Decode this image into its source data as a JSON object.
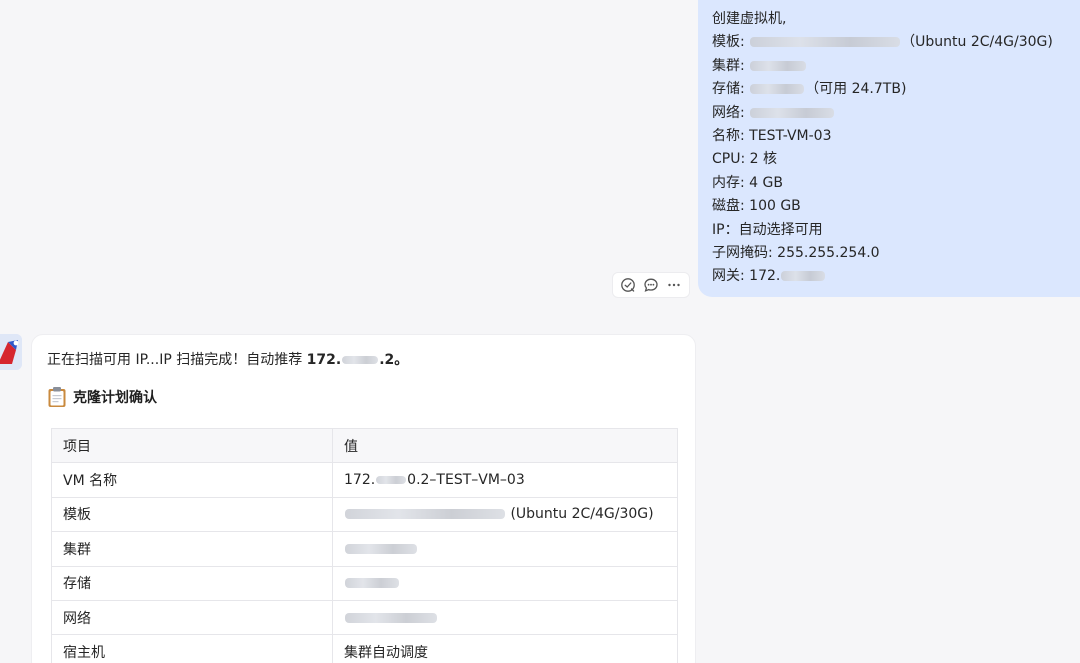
{
  "user_message": {
    "lines": [
      {
        "label": "创建虚拟机,",
        "after": ""
      },
      {
        "label": "模板: ",
        "after": "（Ubuntu 2C/4G/30G)"
      },
      {
        "label": "集群: ",
        "after": ""
      },
      {
        "label": "存储: ",
        "after": "（可用 24.7TB)"
      },
      {
        "label": "网络: ",
        "after": ""
      },
      {
        "label": "名称: TEST-VM-03",
        "after": ""
      },
      {
        "label": "CPU: 2 核",
        "after": ""
      },
      {
        "label": "内存: 4 GB",
        "after": ""
      },
      {
        "label": "磁盘: 100 GB",
        "after": ""
      },
      {
        "label": "IP：自动选择可用",
        "after": ""
      },
      {
        "label": "子网掩码: 255.255.254.0",
        "after": ""
      },
      {
        "label": "网关: 172.",
        "after": ""
      }
    ]
  },
  "actions": {
    "icons": [
      "rewrite-icon",
      "comment-icon",
      "more-icon"
    ]
  },
  "assistant": {
    "status_prefix": "正在扫描可用 IP...IP 扫描完成！自动推荐 ",
    "status_ip_start": "172.",
    "status_ip_end": ".2。",
    "plan_title": "克隆计划确认",
    "table": {
      "headers": [
        "项目",
        "值"
      ],
      "rows": [
        {
          "key": "VM 名称",
          "value_start": "172.",
          "value_end": "0.2–TEST–VM–03"
        },
        {
          "key": "模板",
          "value_start": "",
          "value_end": " (Ubuntu 2C/4G/30G)"
        },
        {
          "key": "集群",
          "value_start": "",
          "value_end": ""
        },
        {
          "key": "存储",
          "value_start": "",
          "value_end": ""
        },
        {
          "key": "网络",
          "value_start": "",
          "value_end": ""
        },
        {
          "key": "宿主机",
          "value_start": "集群自动调度",
          "value_end": ""
        }
      ]
    }
  },
  "colors": {
    "user_bubble": "#dbe7fe",
    "page_bg": "#f6f6f8",
    "card_bg": "#ffffff"
  }
}
